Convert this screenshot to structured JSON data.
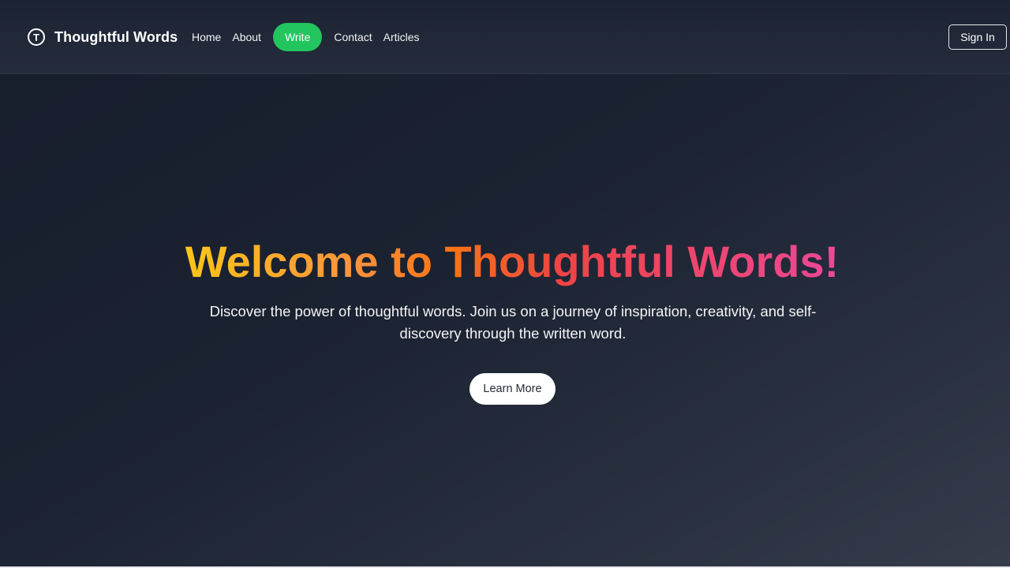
{
  "brand": {
    "logo_icon": "t-circle-logo-icon",
    "logo_letter": "T",
    "name": "Thoughtful Words"
  },
  "nav": {
    "items": [
      {
        "label": "Home"
      },
      {
        "label": "About"
      },
      {
        "label": "Write",
        "active": true
      },
      {
        "label": "Contact"
      },
      {
        "label": "Articles"
      }
    ],
    "sign_in_label": "Sign In"
  },
  "hero": {
    "title": "Welcome to Thoughtful Words!",
    "subtitle": "Discover the power of thoughtful words. Join us on a journey of inspiration, creativity, and self-discovery through the written word.",
    "cta_label": "Learn More"
  },
  "colors": {
    "background": "#1b2231",
    "active_nav": "#22c55e",
    "title_gradient": [
      "#facc15",
      "#f97316",
      "#ef4444",
      "#ec4899"
    ],
    "cta_background": "#ffffff"
  }
}
